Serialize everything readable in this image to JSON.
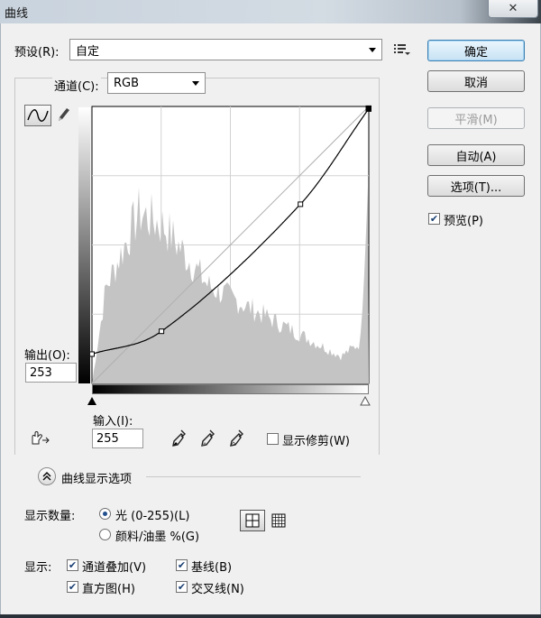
{
  "window": {
    "title": "曲线",
    "close_glyph": "✕"
  },
  "preset": {
    "label": "预设(R):",
    "value": "自定"
  },
  "channel": {
    "label": "通道(C):",
    "value": "RGB"
  },
  "buttons": {
    "ok": "确定",
    "cancel": "取消",
    "smooth": "平滑(M)",
    "auto": "自动(A)",
    "options": "选项(T)..."
  },
  "preview": {
    "label": "预览(P)",
    "checked": true
  },
  "output": {
    "label": "输出(O):",
    "value": "253"
  },
  "input": {
    "label": "输入(I):",
    "value": "255"
  },
  "show_clipping": {
    "label": "显示修剪(W)",
    "checked": false
  },
  "curve_display": {
    "label": "曲线显示选项"
  },
  "show_amount": {
    "label": "显示数量:",
    "option_light": "光 (0-255)(L)",
    "option_pigment": "颜料/油墨 %(G)",
    "selected": "light"
  },
  "show": {
    "label": "显示:",
    "channel_overlays": "通道叠加(V)",
    "baseline": "基线(B)",
    "histogram": "直方图(H)",
    "intersection": "交叉线(N)"
  },
  "curve": {
    "control_points": [
      [
        0,
        27
      ],
      [
        64,
        48
      ],
      [
        192,
        165
      ],
      [
        255,
        253
      ]
    ]
  },
  "colors": {
    "curve": "#000000",
    "histogram": "#c4c4c4",
    "grid": "#d2d2d2",
    "accent": "#23508e"
  }
}
